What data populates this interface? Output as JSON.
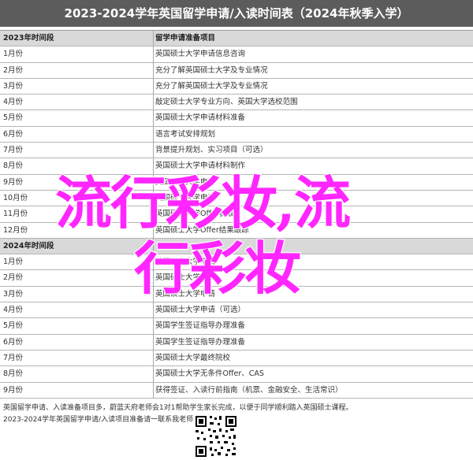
{
  "title": "2023-2024学年英国留学申请/入读时间表（2024年秋季入学）",
  "table": {
    "header": {
      "col1": "2023年时间段",
      "col2": "留学申请准备项目"
    },
    "rows_2023": [
      {
        "period": "1月份",
        "item": "英国硕士大学申请信息咨询"
      },
      {
        "period": "2月份",
        "item": "充分了解英国硕士大学及专业情况"
      },
      {
        "period": "3月份",
        "item": "充分了解英国硕士大学及专业情况"
      },
      {
        "period": "4月份",
        "item": "敲定硕士大学专业方向、英国大学选校范围"
      },
      {
        "period": "5月份",
        "item": "英国硕士大学申请材料准备"
      },
      {
        "period": "6月份",
        "item": "语言考试安排规划"
      },
      {
        "period": "7月份",
        "item": "背景提升规划、实习项目（可选）"
      },
      {
        "period": "8月份",
        "item": "英国硕士大学申请材料制作"
      },
      {
        "period": "9月份",
        "item": "英国硕士大学申请"
      },
      {
        "period": "10月份",
        "item": "英国硕士大学申请"
      },
      {
        "period": "11月份",
        "item": "英国硕士大学Offer获取"
      },
      {
        "period": "12月份",
        "item": "英国硕士大学Offer结果跟踪"
      }
    ],
    "header2": {
      "col1": "2024年时间段",
      "col2": ""
    },
    "rows_2024": [
      {
        "period": "1月份",
        "item": "英国硕士大学申请"
      },
      {
        "period": "2月份",
        "item": "英国硕士大学申请"
      },
      {
        "period": "3月份",
        "item": "英国硕士大学申请"
      },
      {
        "period": "4月份",
        "item": "英国硕士大学申请（可选）"
      },
      {
        "period": "5月份",
        "item": "英国学生签证指导办理准备"
      },
      {
        "period": "6月份",
        "item": "英国学生签证指导办理准备"
      },
      {
        "period": "7月份",
        "item": "英国硕士大学最终院校"
      },
      {
        "period": "8月份",
        "item": "英国硕士大学无条件Offer、CAS"
      },
      {
        "period": "9月份",
        "item": "获得签证、入读行前指南（机票、金融安全、生活常识）"
      }
    ]
  },
  "footer": {
    "line1": "英国留学申请、入读准备项目多，蔚蓝天府老师会1对1帮助学生家长完成，以便于同学顺利踏入英国硕士课程。",
    "line2": "2023-2024学年英国留学申请/入读项目准备请一联系我老师:"
  },
  "overlay": {
    "line1": "流行彩妆,流",
    "line2": "行彩妆"
  },
  "colors": {
    "title_bar": "#5c5c5c",
    "header_row": "#d9d9d9",
    "overlay_text": "#ff26ff"
  }
}
